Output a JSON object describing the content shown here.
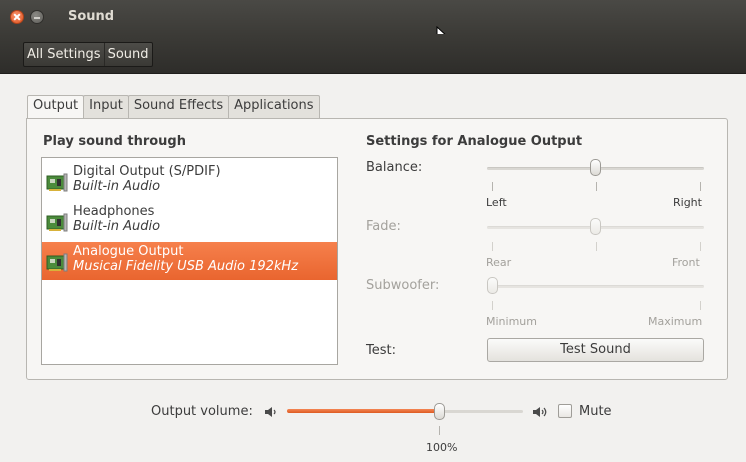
{
  "window": {
    "title": "Sound"
  },
  "toolbar": {
    "breadcrumbs": [
      "All Settings",
      "Sound"
    ]
  },
  "tabs": [
    {
      "label": "Output",
      "active": true
    },
    {
      "label": "Input",
      "active": false
    },
    {
      "label": "Sound Effects",
      "active": false
    },
    {
      "label": "Applications",
      "active": false
    }
  ],
  "play_through": {
    "heading": "Play sound through",
    "devices": [
      {
        "name": "Digital Output (S/PDIF)",
        "description": "Built-in Audio",
        "selected": false
      },
      {
        "name": "Headphones",
        "description": "Built-in Audio",
        "selected": false
      },
      {
        "name": "Analogue Output",
        "description": "Musical Fidelity USB Audio 192kHz",
        "selected": true
      }
    ]
  },
  "settings": {
    "heading": "Settings for Analogue Output",
    "balance": {
      "label": "Balance:",
      "left": "Left",
      "right": "Right",
      "value": 0.5
    },
    "fade": {
      "label": "Fade:",
      "left": "Rear",
      "right": "Front",
      "value": 0.5,
      "enabled": false
    },
    "subwoofer": {
      "label": "Subwoofer:",
      "left": "Minimum",
      "right": "Maximum",
      "value": 0.0,
      "enabled": false
    },
    "test": {
      "label": "Test:",
      "button_label": "Test Sound"
    }
  },
  "output_volume": {
    "label": "Output volume:",
    "tick_label": "100%",
    "mute_label": "Mute",
    "muted": false
  },
  "colors": {
    "accent": "#e9652f",
    "titlebar": "#3c3b37",
    "window_bg": "#f2f1ef"
  }
}
